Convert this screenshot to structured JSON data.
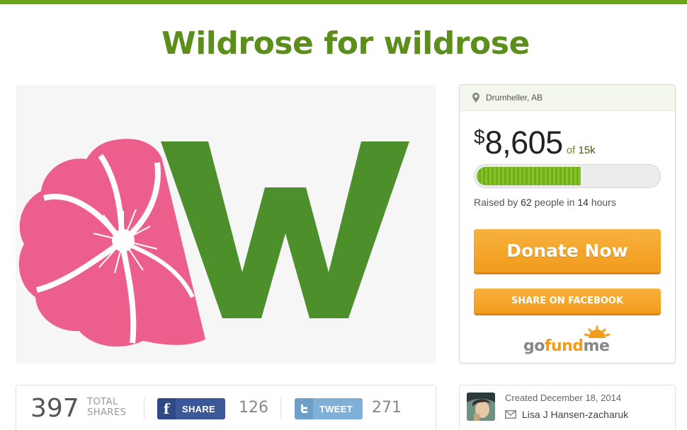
{
  "campaign": {
    "title": "Wildrose for wildrose"
  },
  "sidebar": {
    "location": "Drumheller, AB",
    "currency": "$",
    "amount": "8,605",
    "goal_prefix": "of",
    "goal": "15k",
    "progress_fraction": 0.574,
    "raised_prefix": "Raised by",
    "raised_people": "62",
    "raised_mid": "people in",
    "raised_time": "14",
    "raised_suffix": "hours",
    "donate_label": "Donate Now",
    "share_fb_label": "SHARE ON FACEBOOK",
    "brand_go": "go",
    "brand_fund": "fund",
    "brand_me": "me"
  },
  "sharebar": {
    "total_shares": "397",
    "total_label_1": "TOTAL",
    "total_label_2": "SHARES",
    "fb_label": "SHARE",
    "fb_count": "126",
    "tw_label": "TWEET",
    "tw_count": "271"
  },
  "organizer": {
    "created": "Created December 18, 2014",
    "name": "Lisa J Hansen-zacharuk"
  },
  "icons": {
    "location": "map-pin-icon",
    "facebook": "facebook-icon",
    "twitter": "twitter-icon",
    "mail": "mail-icon"
  },
  "colors": {
    "accent_green": "#5b8e1b",
    "logo_pink": "#ec5f8d",
    "logo_green": "#4c8f2b",
    "donate_orange": "#f29c1c",
    "facebook_blue": "#3b5998",
    "twitter_blue": "#7fb0d8"
  }
}
